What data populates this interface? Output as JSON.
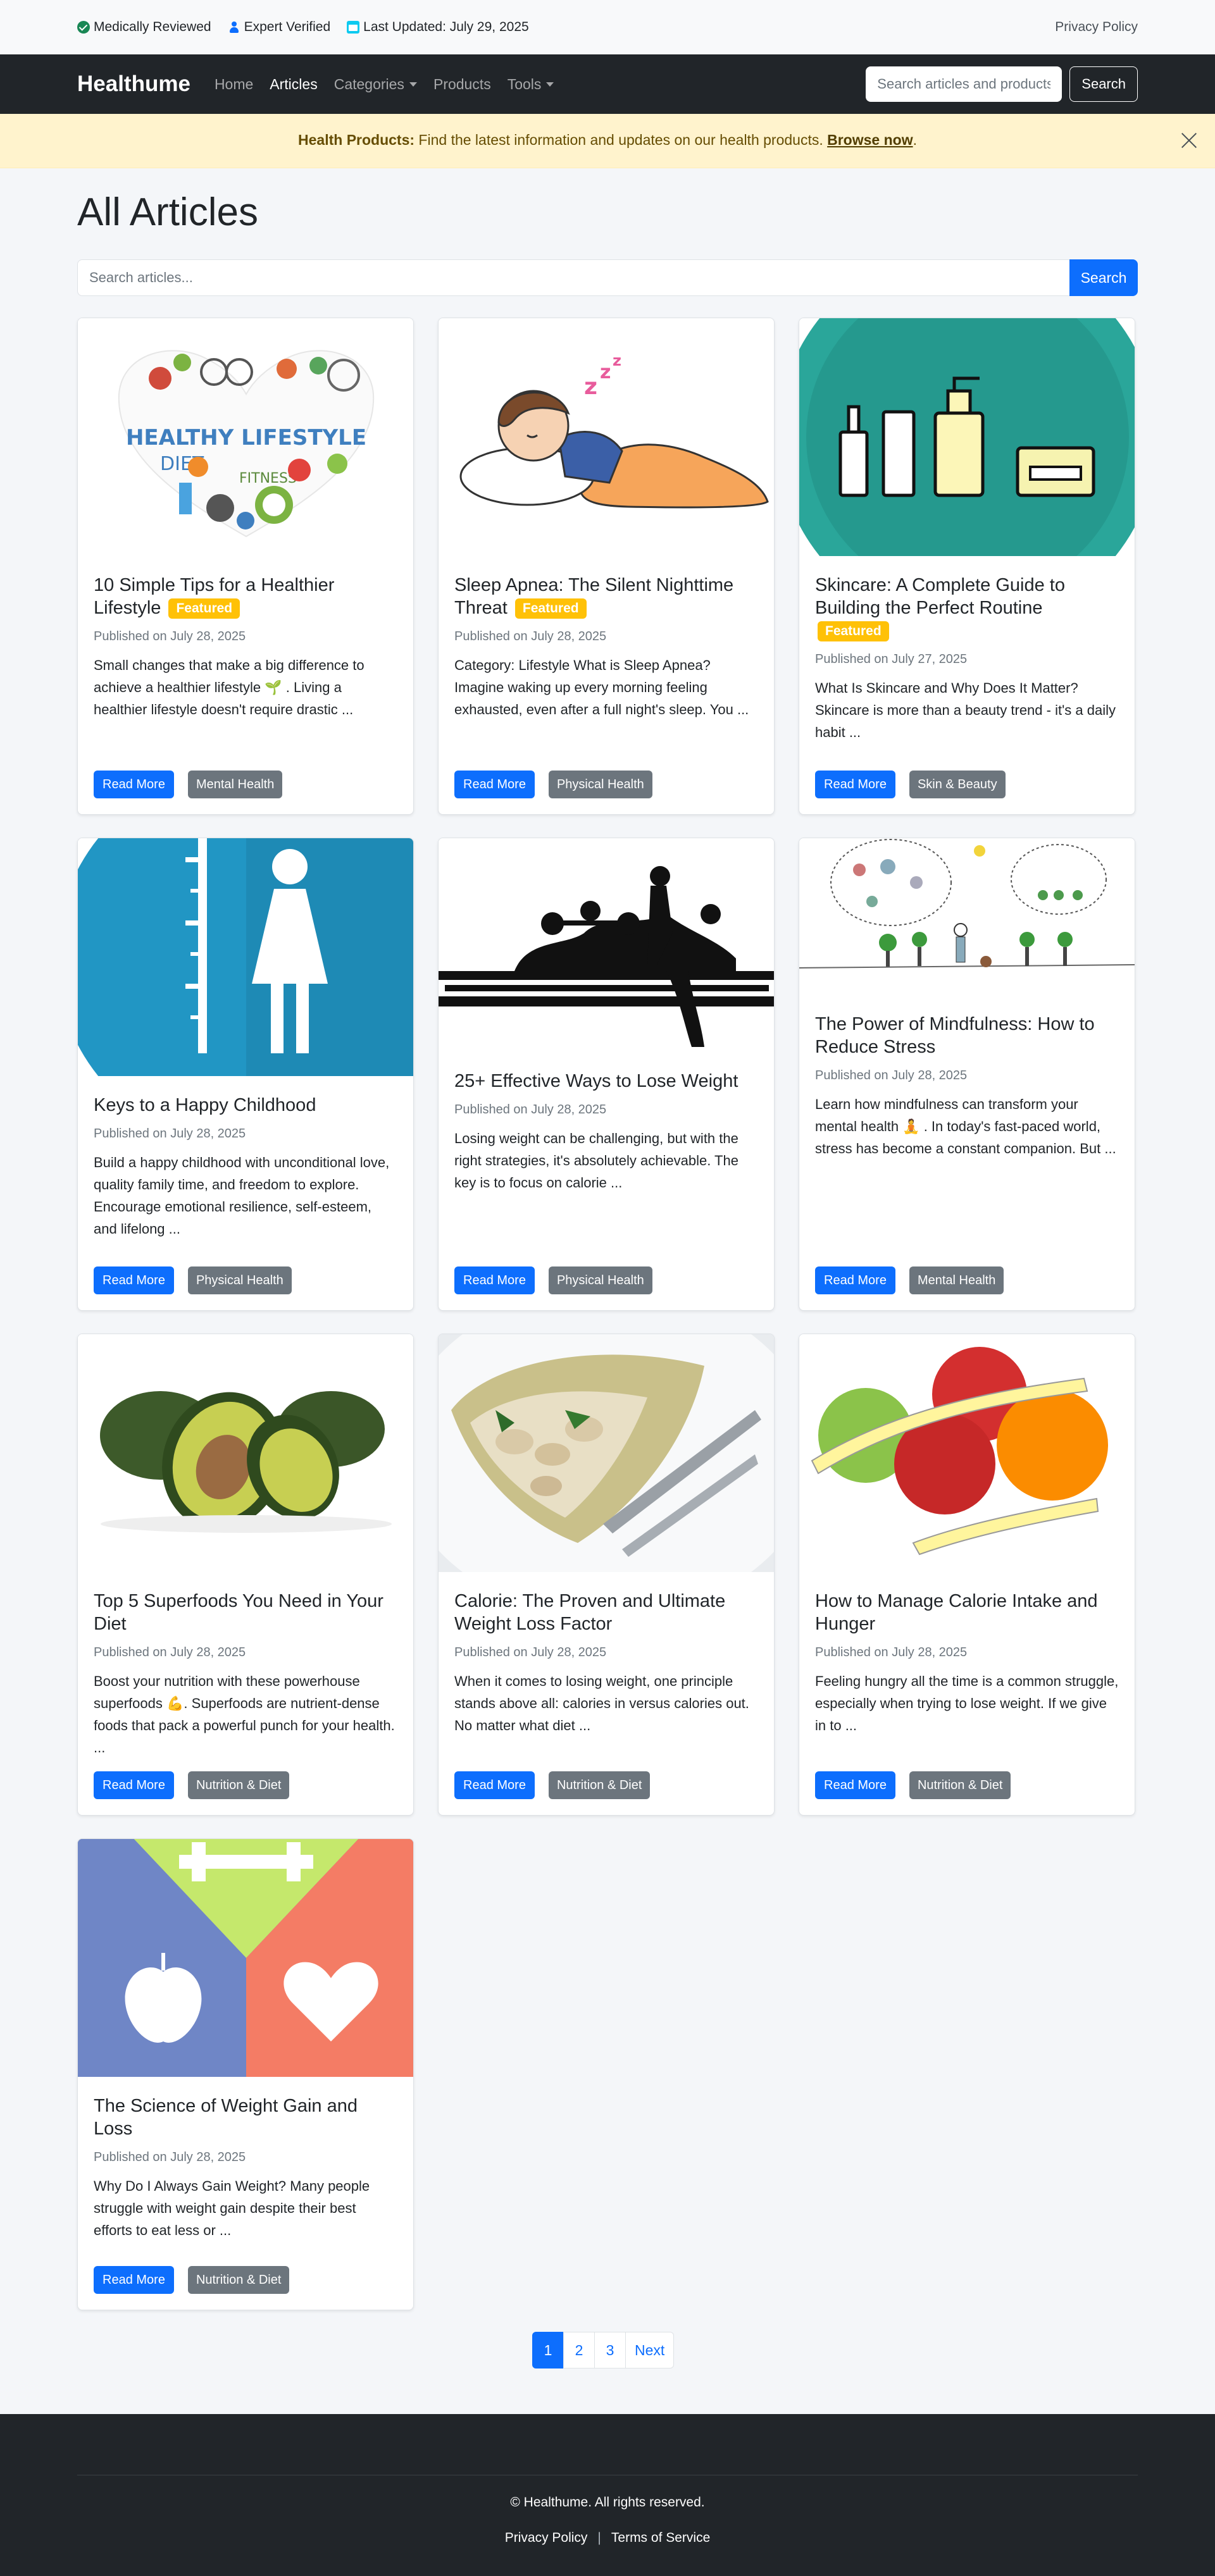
{
  "topbar": {
    "medically_reviewed": "Medically Reviewed",
    "expert_verified": "Expert Verified",
    "last_updated": "Last Updated: July 29, 2025",
    "privacy_policy": "Privacy Policy"
  },
  "navbar": {
    "brand": "Healthume",
    "links": [
      "Home",
      "Articles",
      "Categories",
      "Products",
      "Tools"
    ],
    "search_placeholder": "Search articles and products...",
    "search_button": "Search"
  },
  "alert": {
    "strong": "Health Products:",
    "text": " Find the latest information and updates on our health products. ",
    "link": "Browse now",
    "end": "."
  },
  "main": {
    "title": "All Articles",
    "search_placeholder": "Search articles...",
    "search_button": "Search"
  },
  "articles": [
    {
      "title": "10 Simple Tips for a Healthier Lifestyle",
      "featured": "Featured",
      "date": "Published on July 28, 2025",
      "excerpt": "Small changes that make a big difference to achieve a healthier lifestyle 🌱 . Living a healthier lifestyle doesn't require drastic ...",
      "category": "Mental Health",
      "read_more": "Read More",
      "image": "healthy-lifestyle-heart-image"
    },
    {
      "title": "Sleep Apnea: The Silent Nighttime Threat",
      "featured": "Featured",
      "date": "Published on July 28, 2025",
      "excerpt": "Category: Lifestyle What is Sleep Apnea? Imagine waking up every morning feeling exhausted, even after a full night's sleep. You ...",
      "category": "Physical Health",
      "read_more": "Read More",
      "image": "sleeping-child-image"
    },
    {
      "title": "Skincare: A Complete Guide to Building the Perfect Routine",
      "featured": "Featured",
      "date": "Published on July 27, 2025",
      "excerpt": "What Is Skincare and Why Does It Matter? Skincare is more than a beauty trend - it's a daily habit ...",
      "category": "Skin & Beauty",
      "read_more": "Read More",
      "image": "skincare-products-image"
    },
    {
      "title": "Keys to a Happy Childhood",
      "featured": "",
      "date": "Published on July 28, 2025",
      "excerpt": "Build a happy childhood with unconditional love, quality family time, and freedom to explore. Encourage emotional resilience, self-esteem, and lifelong ...",
      "category": "Physical Health",
      "read_more": "Read More",
      "image": "child-height-image"
    },
    {
      "title": "25+ Effective Ways to Lose Weight",
      "featured": "",
      "date": "Published on July 28, 2025",
      "excerpt": "Losing weight can be challenging, but with the right strategies, it's absolutely achievable. The key is to focus on calorie ...",
      "category": "Physical Health",
      "read_more": "Read More",
      "image": "fitness-silhouette-image"
    },
    {
      "title": "The Power of Mindfulness: How to Reduce Stress",
      "featured": "",
      "date": "Published on July 28, 2025",
      "excerpt": "Learn how mindfulness can transform your mental health 🧘 . In today's fast-paced world, stress has become a constant companion. But ...",
      "category": "Mental Health",
      "read_more": "Read More",
      "image": "mindfulness-sketch-image"
    },
    {
      "title": "Top 5 Superfoods You Need in Your Diet",
      "featured": "",
      "date": "Published on July 28, 2025",
      "excerpt": "Boost your nutrition with these powerhouse superfoods 💪. Superfoods are nutrient-dense foods that pack a powerful punch for your health. ...",
      "category": "Nutrition & Diet",
      "read_more": "Read More",
      "image": "avocado-image"
    },
    {
      "title": "Calorie: The Proven and Ultimate Weight Loss Factor",
      "featured": "",
      "date": "Published on July 28, 2025",
      "excerpt": "When it comes to losing weight, one principle stands above all: calories in versus calories out. No matter what diet ...",
      "category": "Nutrition & Diet",
      "read_more": "Read More",
      "image": "wrap-plate-image"
    },
    {
      "title": "How to Manage Calorie Intake and Hunger",
      "featured": "",
      "date": "Published on July 28, 2025",
      "excerpt": "Feeling hungry all the time is a common struggle, especially when trying to lose weight. If we give in to ...",
      "category": "Nutrition & Diet",
      "read_more": "Read More",
      "image": "fruits-tape-image"
    },
    {
      "title": "The Science of Weight Gain and Loss",
      "featured": "",
      "date": "Published on July 28, 2025",
      "excerpt": "Why Do I Always Gain Weight? Many people struggle with weight gain despite their best efforts to eat less or ...",
      "category": "Nutrition & Diet",
      "read_more": "Read More",
      "image": "health-icons-image"
    }
  ],
  "pagination": {
    "pages": [
      "1",
      "2",
      "3"
    ],
    "next": "Next"
  },
  "footer": {
    "copyright": "© Healthume. All rights reserved.",
    "privacy": "Privacy Policy",
    "separator": "|",
    "terms": "Terms of Service"
  }
}
